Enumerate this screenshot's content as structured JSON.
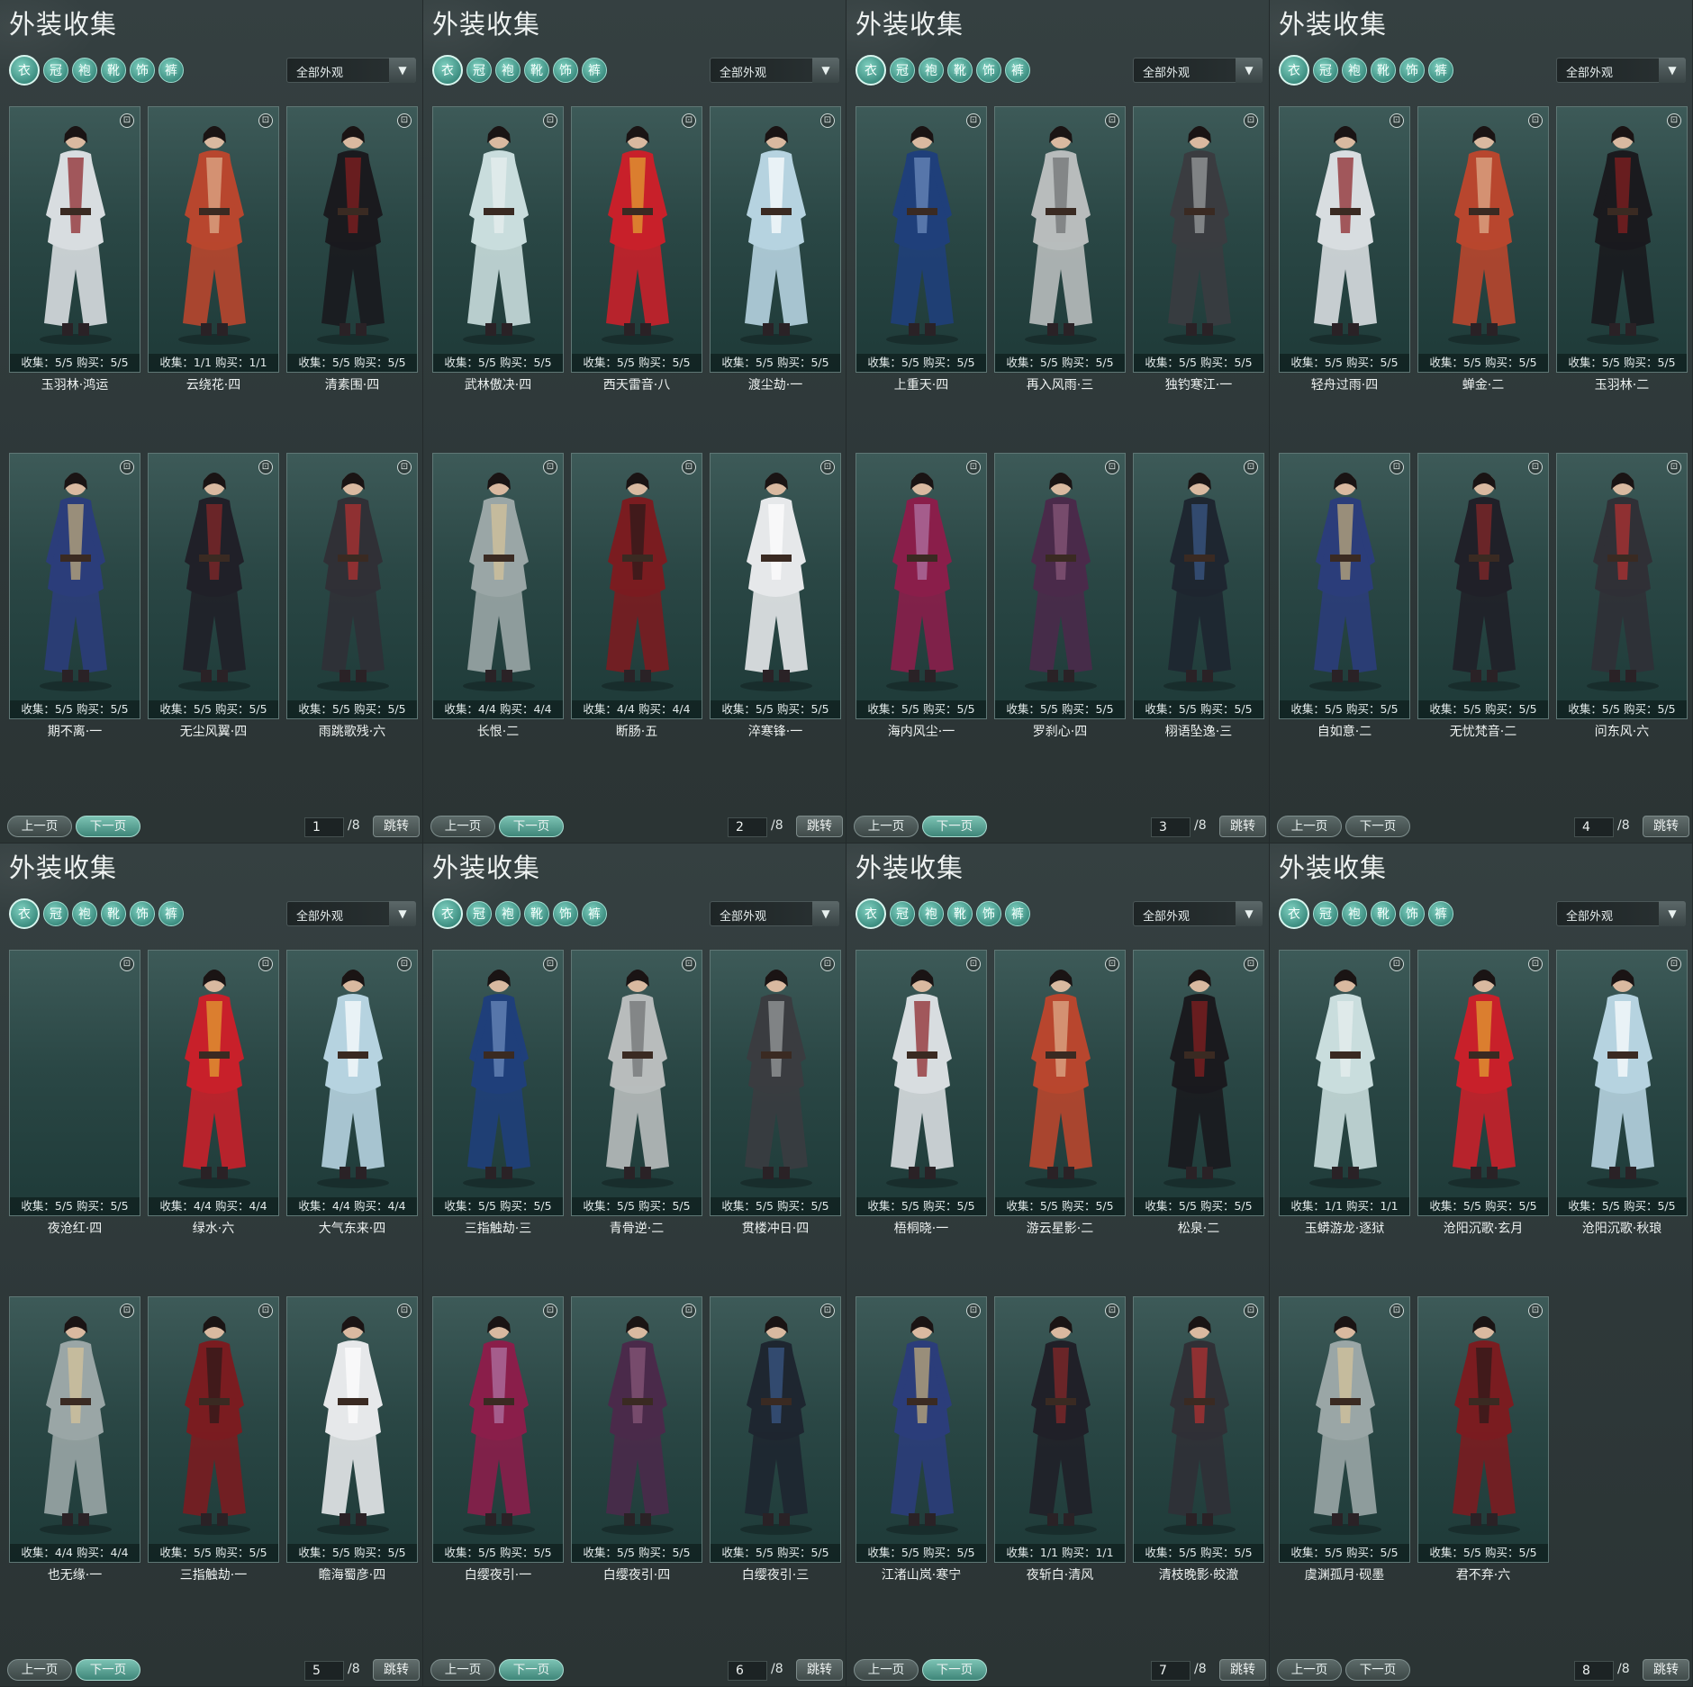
{
  "panels": [
    {
      "title": "外装收集",
      "dropdown": "全部外观",
      "items": [
        {
          "name": "玉羽林·鸿运",
          "stats": "收集：5/5   购买：5/5"
        },
        {
          "name": "云绕花·四",
          "stats": "收集：1/1   购买：1/1"
        },
        {
          "name": "清素围·四",
          "stats": "收集：5/5   购买：5/5"
        },
        {
          "name": "期不离·一",
          "stats": "收集：5/5   购买：5/5"
        },
        {
          "name": "无尘风翼·四",
          "stats": "收集：5/5   购买：5/5"
        },
        {
          "name": "雨跳歌残·六",
          "stats": "收集：5/5   购买：5/5"
        }
      ],
      "page": "1",
      "total": "/8"
    },
    {
      "title": "外装收集",
      "dropdown": "全部外观",
      "items": [
        {
          "name": "武林傲决·四",
          "stats": "收集：5/5   购买：5/5"
        },
        {
          "name": "西天雷音·八",
          "stats": "收集：5/5   购买：5/5"
        },
        {
          "name": "渡尘劫·一",
          "stats": "收集：5/5   购买：5/5"
        },
        {
          "name": "长恨·二",
          "stats": "收集：4/4   购买：4/4"
        },
        {
          "name": "断肠·五",
          "stats": "收集：4/4   购买：4/4"
        },
        {
          "name": "淬寒锋·一",
          "stats": "收集：5/5   购买：5/5"
        }
      ],
      "page": "2",
      "total": "/8"
    },
    {
      "title": "外装收集",
      "dropdown": "全部外观",
      "items": [
        {
          "name": "上重天·四",
          "stats": "收集：5/5   购买：5/5"
        },
        {
          "name": "再入风雨·三",
          "stats": "收集：5/5   购买：5/5"
        },
        {
          "name": "独钓寒江·一",
          "stats": "收集：5/5   购买：5/5"
        },
        {
          "name": "海内风尘·一",
          "stats": "收集：5/5   购买：5/5"
        },
        {
          "name": "罗刹心·四",
          "stats": "收集：5/5   购买：5/5"
        },
        {
          "name": "栩语坠逸·三",
          "stats": "收集：5/5   购买：5/5"
        }
      ],
      "page": "3",
      "total": "/8"
    },
    {
      "title": "外装收集",
      "dropdown": "全部外观",
      "items": [
        {
          "name": "轻舟过雨·四",
          "stats": "收集：5/5   购买：5/5"
        },
        {
          "name": "蝉金·二",
          "stats": "收集：5/5   购买：5/5"
        },
        {
          "name": "玉羽林·二",
          "stats": "收集：5/5   购买：5/5"
        },
        {
          "name": "自如意·二",
          "stats": "收集：5/5   购买：5/5"
        },
        {
          "name": "无忧梵音·二",
          "stats": "收集：5/5   购买：5/5"
        },
        {
          "name": "问东风·六",
          "stats": "收集：5/5   购买：5/5"
        }
      ],
      "page": "4",
      "total": "/8"
    },
    {
      "title": "外装收集",
      "dropdown": "全部外观",
      "items": [
        {
          "name": "夜沧红·四",
          "stats": "收集：5/5   购买：5/5"
        },
        {
          "name": "绿水·六",
          "stats": "收集：4/4   购买：4/4"
        },
        {
          "name": "大气东来·四",
          "stats": "收集：4/4   购买：4/4"
        },
        {
          "name": "也无缘·一",
          "stats": "收集：4/4   购买：4/4"
        },
        {
          "name": "三指触劫·一",
          "stats": "收集：5/5   购买：5/5"
        },
        {
          "name": "瞻海蜀彦·四",
          "stats": "收集：5/5   购买：5/5"
        }
      ],
      "page": "5",
      "total": "/8"
    },
    {
      "title": "外装收集",
      "dropdown": "全部外观",
      "items": [
        {
          "name": "三指触劫·三",
          "stats": "收集：5/5   购买：5/5"
        },
        {
          "name": "青骨逆·二",
          "stats": "收集：5/5   购买：5/5"
        },
        {
          "name": "贯楼冲日·四",
          "stats": "收集：5/5   购买：5/5"
        },
        {
          "name": "白缨夜引·一",
          "stats": "收集：5/5   购买：5/5"
        },
        {
          "name": "白缨夜引·四",
          "stats": "收集：5/5   购买：5/5"
        },
        {
          "name": "白缨夜引·三",
          "stats": "收集：5/5   购买：5/5"
        }
      ],
      "page": "6",
      "total": "/8"
    },
    {
      "title": "外装收集",
      "dropdown": "全部外观",
      "items": [
        {
          "name": "梧桐晓·一",
          "stats": "收集：5/5   购买：5/5"
        },
        {
          "name": "游云星影·二",
          "stats": "收集：5/5   购买：5/5"
        },
        {
          "name": "松泉·二",
          "stats": "收集：5/5   购买：5/5"
        },
        {
          "name": "江渚山岚·寒宁",
          "stats": "收集：5/5   购买：5/5"
        },
        {
          "name": "夜斩白·清风",
          "stats": "收集：1/1   购买：1/1"
        },
        {
          "name": "清枝晚影·皎澈",
          "stats": "收集：5/5   购买：5/5"
        }
      ],
      "page": "7",
      "total": "/8"
    },
    {
      "title": "外装收集",
      "dropdown": "全部外观",
      "items": [
        {
          "name": "玉蟒游龙·逐狱",
          "stats": "收集：1/1   购买：1/1"
        },
        {
          "name": "沧阳沉歌·玄月",
          "stats": "收集：5/5   购买：5/5"
        },
        {
          "name": "沧阳沉歌·秋琅",
          "stats": "收集：5/5   购买：5/5"
        },
        {
          "name": "虞渊孤月·砚墨",
          "stats": "收集：5/5   购买：5/5"
        },
        {
          "name": "君不弃·六",
          "stats": "收集：5/5   购买：5/5"
        }
      ],
      "page": "8",
      "total": "/8"
    }
  ],
  "pager": {
    "prev": "上一页",
    "next": "下一页",
    "jump": "跳转"
  },
  "colors": {
    "accent": "#4f9e90",
    "panel_bg": "#2e3839",
    "card_bg": "#2a4745"
  }
}
